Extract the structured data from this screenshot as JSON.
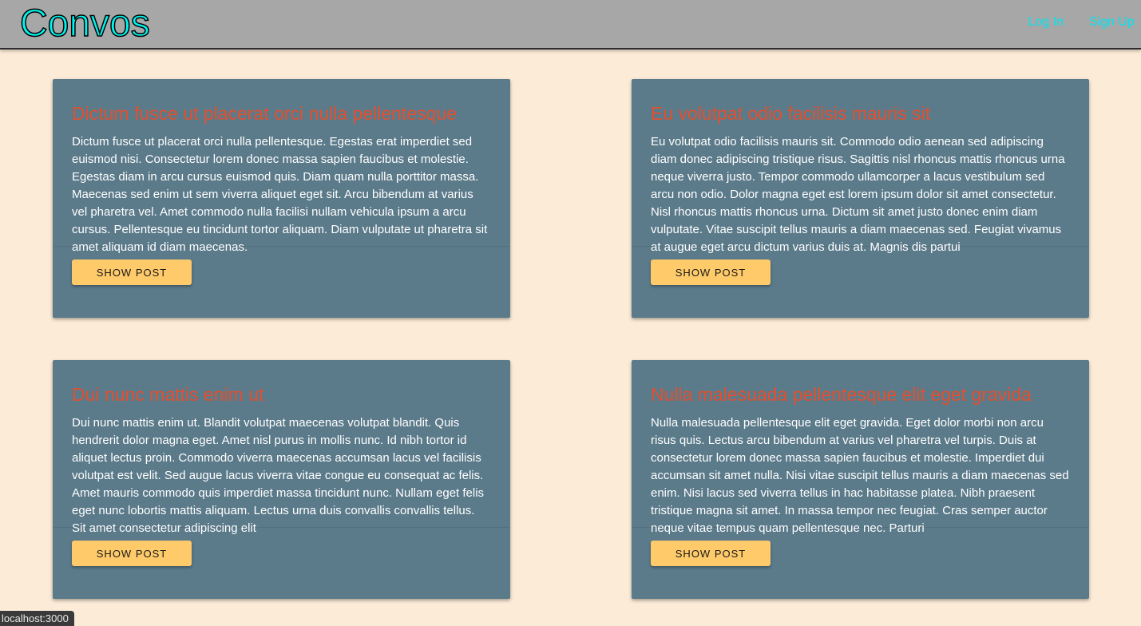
{
  "navbar": {
    "brand": "Convos",
    "login_label": "Log In",
    "signup_label": "Sign Up"
  },
  "posts": [
    {
      "title": "Dictum fusce ut placerat orci nulla pellentesque",
      "body": "Dictum fusce ut placerat orci nulla pellentesque. Egestas erat imperdiet sed euismod nisi. Consectetur lorem donec massa sapien faucibus et molestie. Egestas diam in arcu cursus euismod quis. Diam quam nulla porttitor massa. Maecenas sed enim ut sem viverra aliquet eget sit. Arcu bibendum at varius vel pharetra vel. Amet commodo nulla facilisi nullam vehicula ipsum a arcu cursus. Pellentesque eu tincidunt tortor aliquam. Diam vulputate ut pharetra sit amet aliquam id diam maecenas.",
      "button_label": "SHOW POST"
    },
    {
      "title": "Eu volutpat odio facilisis mauris sit",
      "body": "Eu volutpat odio facilisis mauris sit. Commodo odio aenean sed adipiscing diam donec adipiscing tristique risus. Sagittis nisl rhoncus mattis rhoncus urna neque viverra justo. Tempor commodo ullamcorper a lacus vestibulum sed arcu non odio. Dolor magna eget est lorem ipsum dolor sit amet consectetur. Nisl rhoncus mattis rhoncus urna. Dictum sit amet justo donec enim diam vulputate. Vitae suscipit tellus mauris a diam maecenas sed. Feugiat vivamus at augue eget arcu dictum varius duis at. Magnis dis partui",
      "button_label": "SHOW POST"
    },
    {
      "title": "Dui nunc mattis enim ut",
      "body": "Dui nunc mattis enim ut. Blandit volutpat maecenas volutpat blandit. Quis hendrerit dolor magna eget. Amet nisl purus in mollis nunc. Id nibh tortor id aliquet lectus proin. Commodo viverra maecenas accumsan lacus vel facilisis volutpat est velit. Sed augue lacus viverra vitae congue eu consequat ac felis. Amet mauris commodo quis imperdiet massa tincidunt nunc. Nullam eget felis eget nunc lobortis mattis aliquam. Lectus urna duis convallis convallis tellus. Sit amet consectetur adipiscing elit",
      "button_label": "SHOW POST"
    },
    {
      "title": "Nulla malesuada pellentesque elit eget gravida",
      "body": "Nulla malesuada pellentesque elit eget gravida. Eget dolor morbi non arcu risus quis. Lectus arcu bibendum at varius vel pharetra vel turpis. Duis at consectetur lorem donec massa sapien faucibus et molestie. Imperdiet dui accumsan sit amet nulla. Nisi vitae suscipit tellus mauris a diam maecenas sed enim. Nisi lacus sed viverra tellus in hac habitasse platea. Nibh praesent tristique magna sit amet. In massa tempor nec feugiat. Cras semper auctor neque vitae tempus quam pellentesque nec. Parturi",
      "button_label": "SHOW POST"
    }
  ],
  "status_bar": {
    "url": "localhost:3000"
  },
  "colors": {
    "page_background": "#fcebd7",
    "navbar_background": "#a7a7a7",
    "brand_color": "#00f5f0",
    "nav_link_color": "#00e5f0",
    "card_background": "#5b7a8a",
    "card_title_color": "#e2502f",
    "button_background": "#ffca6a"
  }
}
